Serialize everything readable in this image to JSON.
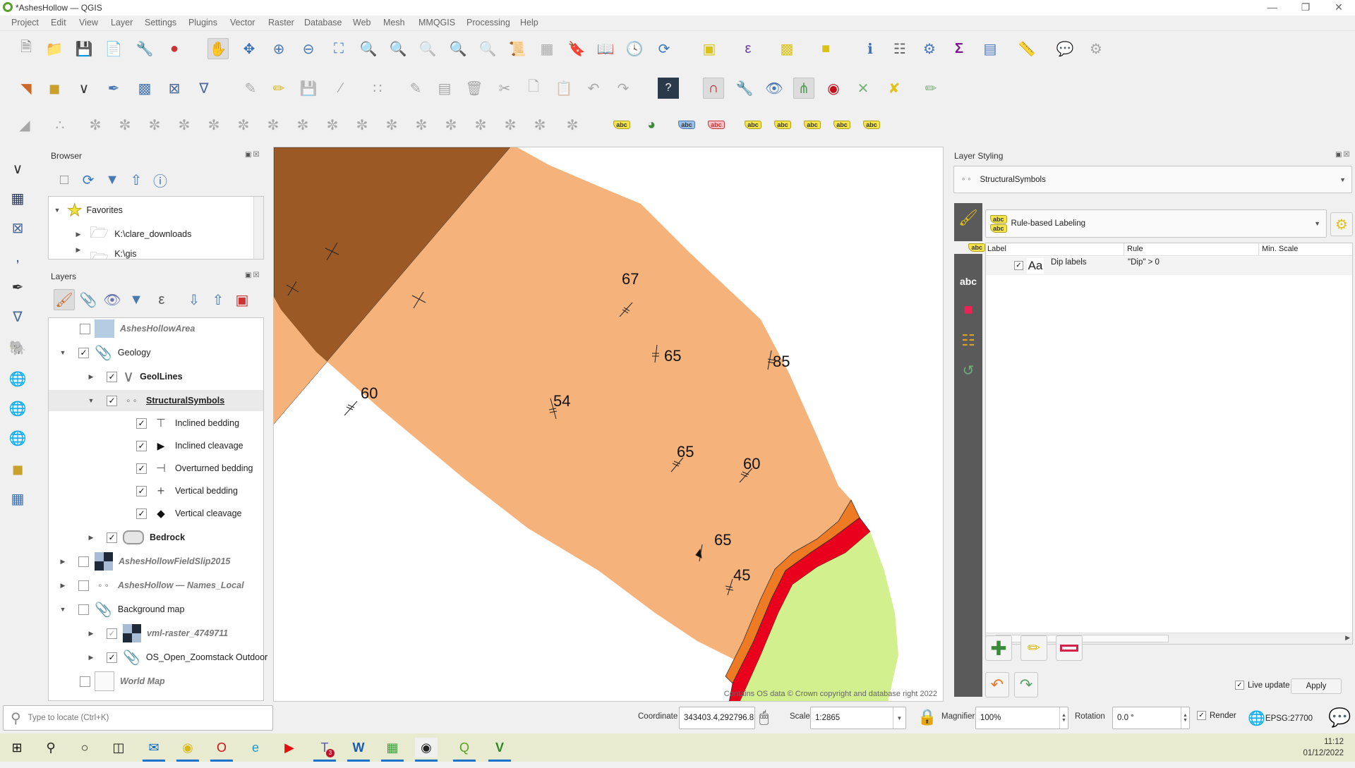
{
  "window": {
    "title": "*AshesHollow — QGIS",
    "controls": [
      "minimize-icon",
      "restore-icon",
      "close-icon"
    ]
  },
  "menu": [
    "Project",
    "Edit",
    "View",
    "Layer",
    "Settings",
    "Plugins",
    "Vector",
    "Raster",
    "Database",
    "Web",
    "Mesh",
    "MMQGIS",
    "Processing",
    "Help"
  ],
  "toolbars": {
    "row1": [
      "new-project",
      "open-project",
      "save-project",
      "new-print-layout",
      "style-manager",
      "labels-toolbar",
      "pan-map",
      "pan-to-selection",
      "zoom-in",
      "zoom-out",
      "zoom-full",
      "zoom-to-selection",
      "zoom-to-layer",
      "zoom-native",
      "zoom-last",
      "zoom-next",
      "new-map-view",
      "new-3d-map-view",
      "new-bookmark",
      "show-bookmarks",
      "temporal-controller",
      "refresh",
      "select-features",
      "select-by-expression",
      "deselect",
      "select-by-location",
      "identify-features",
      "open-field-calculator",
      "toolbox",
      "statistical-summary",
      "attribute-table",
      "measure-line",
      "map-tips",
      "run-action"
    ],
    "row2": [
      "data-source-manager",
      "new-geopackage-layer",
      "new-shapefile-layer",
      "new-spatialite-layer",
      "new-virtual-layer",
      "new-temporary-scratch-layer",
      "new-mesh-layer",
      "current-edits",
      "toggle-editing",
      "save-layer-edits",
      "digitize-with-segment",
      "vertex-tool",
      "modify-attributes",
      "delete-selected",
      "cut-features",
      "copy-features",
      "paste-features",
      "undo",
      "redo",
      "help",
      "snapping-toggle",
      "advanced-config",
      "topological-editing",
      "snapping-on-intersection",
      "tracing",
      "self-snapping",
      "split-features",
      "geometry-checker"
    ],
    "row3_labels": [
      "abc",
      "abc",
      "abc",
      "abc",
      "abc",
      "abc",
      "abc",
      "abc",
      "abc"
    ]
  },
  "browser": {
    "title": "Browser",
    "items": [
      {
        "label": "Favorites",
        "expanded": true
      },
      {
        "label": "K:\\clare_downloads",
        "expanded": false
      },
      {
        "label": "K:\\gis",
        "expanded": false
      }
    ]
  },
  "layers": {
    "title": "Layers",
    "items": [
      {
        "label": "AshesHollowArea",
        "checked": false,
        "style": "italic"
      },
      {
        "label": "Geology",
        "checked": true,
        "style": "group",
        "expanded": true
      },
      {
        "label": "GeolLines",
        "checked": true,
        "style": "bold"
      },
      {
        "label": "StructuralSymbols",
        "checked": true,
        "style": "bold-underline",
        "expanded": true,
        "selected": true
      },
      {
        "label": "Inclined bedding",
        "checked": true
      },
      {
        "label": "Inclined cleavage",
        "checked": true
      },
      {
        "label": "Overturned bedding",
        "checked": true
      },
      {
        "label": "Vertical bedding",
        "checked": true
      },
      {
        "label": "Vertical cleavage",
        "checked": true
      },
      {
        "label": "Bedrock",
        "checked": true,
        "style": "bold"
      },
      {
        "label": "AshesHollowFieldSlip2015",
        "checked": false,
        "style": "italic"
      },
      {
        "label": "AshesHollow — Names_Local",
        "checked": false,
        "style": "italic"
      },
      {
        "label": "Background map",
        "checked": false,
        "style": "group",
        "expanded": true
      },
      {
        "label": "vml-raster_4749711",
        "checked": true,
        "style": "italic"
      },
      {
        "label": "OS_Open_Zoomstack Outdoor",
        "checked": true
      },
      {
        "label": "World Map",
        "checked": false,
        "style": "italic"
      }
    ]
  },
  "map": {
    "dip_labels": [
      "67",
      "65",
      "85",
      "60",
      "54",
      "65",
      "60",
      "65",
      "45"
    ],
    "attribution": "Contains OS data © Crown copyright and database right 2022",
    "colors": {
      "brown": "#9b5a25",
      "salmon": "#f6b27b",
      "orange": "#ee7a24",
      "red": "#e8001c",
      "green": "#d3f08e"
    }
  },
  "styling": {
    "title": "Layer Styling",
    "layer": "StructuralSymbols",
    "renderer": "Rule-based Labeling",
    "columns": [
      "Label",
      "Rule",
      "Min. Scale"
    ],
    "rules": [
      {
        "checked": true,
        "preview": "Aa",
        "label": "Dip labels",
        "rule": "\"Dip\" > 0",
        "min_scale": ""
      }
    ],
    "live_update_label": "Live update",
    "live_update": true,
    "apply_label": "Apply"
  },
  "status": {
    "locator_placeholder": "Type to locate (Ctrl+K)",
    "coordinate_label": "Coordinate",
    "coordinate": "343403.4,292796.8",
    "scale_label": "Scale",
    "scale": "1:2865",
    "magnifier_label": "Magnifier",
    "magnifier": "100%",
    "rotation_label": "Rotation",
    "rotation": "0.0 °",
    "render_label": "Render",
    "render": true,
    "crs": "EPSG:27700"
  },
  "taskbar": {
    "apps": [
      "windows-start",
      "search",
      "cortana",
      "task-view",
      "outlook",
      "app-yellow",
      "opera",
      "edge",
      "youtube",
      "teams",
      "word",
      "libreoffice-calc",
      "obs",
      "qgis",
      "vim"
    ],
    "teams_badge": "3",
    "time": "11:12",
    "date": "01/12/2022"
  }
}
